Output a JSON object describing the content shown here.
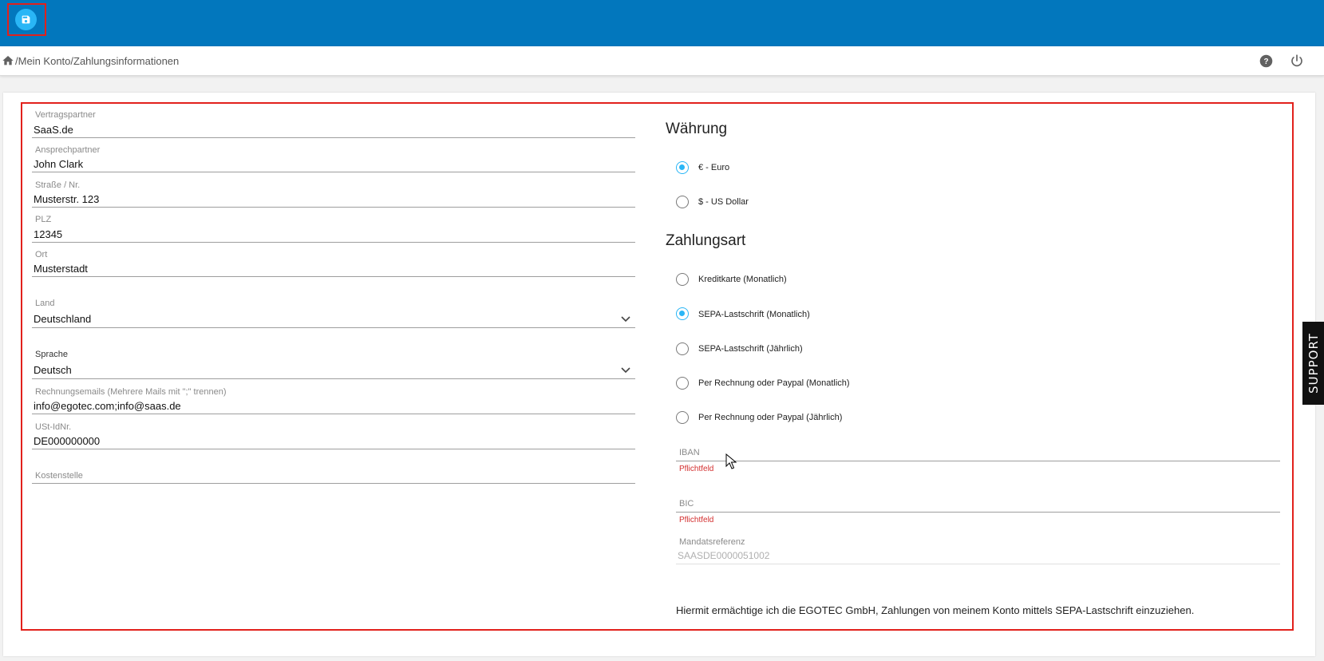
{
  "topbar": {
    "save_icon": "floppy-disk-icon",
    "accent": "#0277bd"
  },
  "breadcrumb": {
    "separator": "/",
    "items": [
      "Mein Konto",
      "Zahlungsinformationen"
    ],
    "home_icon": "home-icon"
  },
  "header_actions": {
    "help_icon": "help-circle-icon",
    "power_icon": "power-icon"
  },
  "left_form": {
    "fields": [
      {
        "label": "Vertragspartner",
        "value": "SaaS.de"
      },
      {
        "label": "Ansprechpartner",
        "value": "John Clark"
      },
      {
        "label": "Straße / Nr.",
        "value": "Musterstr. 123"
      },
      {
        "label": "PLZ",
        "value": "12345"
      },
      {
        "label": "Ort",
        "value": "Musterstadt"
      }
    ],
    "land": {
      "label": "Land",
      "value": "Deutschland"
    },
    "sprache": {
      "label": "Sprache",
      "value": "Deutsch"
    },
    "rechnungsemails": {
      "label": "Rechnungsemails (Mehrere Mails mit \";\" trennen)",
      "value": "info@egotec.com;info@saas.de"
    },
    "ustid": {
      "label": "USt-IdNr.",
      "value": "DE000000000"
    },
    "kostenstelle": {
      "label": "Kostenstelle",
      "value": ""
    }
  },
  "waehrung": {
    "title": "Währung",
    "options": [
      {
        "label": "€ - Euro",
        "selected": true
      },
      {
        "label": "$ - US Dollar",
        "selected": false
      }
    ]
  },
  "zahlungsart": {
    "title": "Zahlungsart",
    "options": [
      {
        "label": "Kreditkarte (Monatlich)",
        "selected": false
      },
      {
        "label": "SEPA-Lastschrift (Monatlich)",
        "selected": true
      },
      {
        "label": "SEPA-Lastschrift (Jährlich)",
        "selected": false
      },
      {
        "label": "Per Rechnung oder Paypal (Monatlich)",
        "selected": false
      },
      {
        "label": "Per Rechnung oder Paypal (Jährlich)",
        "selected": false
      }
    ]
  },
  "sepa": {
    "iban": {
      "label": "IBAN",
      "value": "",
      "error": "Pflichtfeld"
    },
    "bic": {
      "label": "BIC",
      "value": "",
      "error": "Pflichtfeld"
    },
    "mandatsreferenz": {
      "label": "Mandatsreferenz",
      "value": "SAASDE0000051002"
    },
    "authorization_text": "Hiermit ermächtige ich die EGOTEC GmbH, Zahlungen von meinem Konto mittels SEPA-Lastschrift einzuziehen."
  },
  "support_tab": {
    "label": "SUPPORT"
  },
  "colors": {
    "radio_selected": "#29b6f6",
    "error": "#d32f2f",
    "highlight": "#e2211c"
  }
}
